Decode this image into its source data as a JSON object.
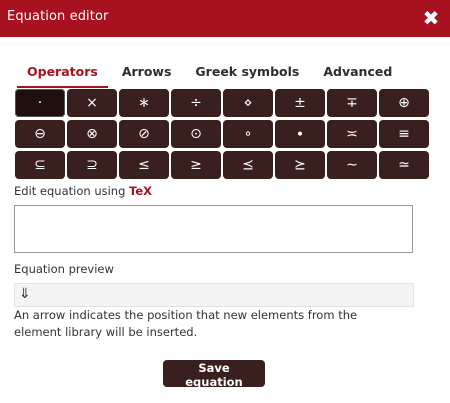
{
  "window": {
    "title": "Equation editor",
    "close_icon": "close-icon"
  },
  "tabs": [
    {
      "label": "Operators",
      "active": true
    },
    {
      "label": "Arrows",
      "active": false
    },
    {
      "label": "Greek symbols",
      "active": false
    },
    {
      "label": "Advanced",
      "active": false
    }
  ],
  "symbols": [
    {
      "glyph": "·",
      "name": "cdot"
    },
    {
      "glyph": "×",
      "name": "times"
    },
    {
      "glyph": "∗",
      "name": "ast"
    },
    {
      "glyph": "÷",
      "name": "div"
    },
    {
      "glyph": "⋄",
      "name": "diamond"
    },
    {
      "glyph": "±",
      "name": "pm"
    },
    {
      "glyph": "∓",
      "name": "mp"
    },
    {
      "glyph": "⊕",
      "name": "oplus"
    },
    {
      "glyph": "⊖",
      "name": "ominus"
    },
    {
      "glyph": "⊗",
      "name": "otimes"
    },
    {
      "glyph": "⊘",
      "name": "oslash"
    },
    {
      "glyph": "⊙",
      "name": "odot"
    },
    {
      "glyph": "∘",
      "name": "circ"
    },
    {
      "glyph": "∙",
      "name": "bullet"
    },
    {
      "glyph": "≍",
      "name": "asymp"
    },
    {
      "glyph": "≡",
      "name": "equiv"
    },
    {
      "glyph": "⊆",
      "name": "subseteq"
    },
    {
      "glyph": "⊇",
      "name": "supseteq"
    },
    {
      "glyph": "≤",
      "name": "leq"
    },
    {
      "glyph": "≥",
      "name": "geq"
    },
    {
      "glyph": "⪯",
      "name": "preceq"
    },
    {
      "glyph": "⪰",
      "name": "succeq"
    },
    {
      "glyph": "∼",
      "name": "sim"
    },
    {
      "glyph": "≃",
      "name": "simeq"
    }
  ],
  "editor": {
    "label_prefix": "Edit equation using",
    "label_tex": "TeX",
    "value": "",
    "placeholder": ""
  },
  "preview": {
    "label": "Equation preview",
    "content": "⇓"
  },
  "note": "An arrow indicates the position that new elements from the element library will be inserted.",
  "save_label": "Save equation",
  "colors": {
    "accent": "#a8111f",
    "button_bg": "#3a1f1f"
  }
}
